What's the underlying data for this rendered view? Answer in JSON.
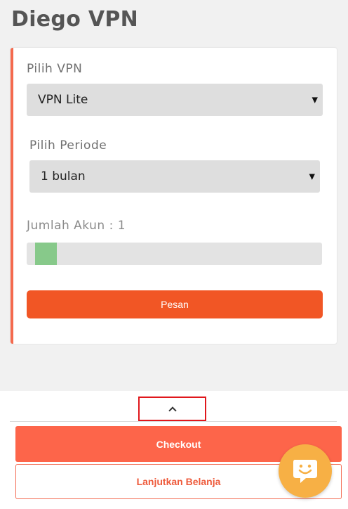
{
  "header": {
    "title": "Diego VPN"
  },
  "form": {
    "vpn_label": "Pilih VPN",
    "vpn_selected": "VPN Lite",
    "period_label": "Pilih Periode",
    "period_selected": "1 bulan",
    "accounts_label": "Jumlah Akun : 1",
    "accounts_slider_fraction": 0.03,
    "order_button": "Pesan"
  },
  "bottom": {
    "expand_icon": "chevron-up-icon",
    "checkout_button": "Checkout",
    "continue_button": "Lanjutkan Belanja"
  },
  "fab": {
    "icon": "chat-smile-icon"
  },
  "colors": {
    "accent": "#f15625",
    "checkout": "#fd654a",
    "slider_thumb": "#87c98a",
    "fab": "#f7b045",
    "highlight": "#e0171c"
  }
}
